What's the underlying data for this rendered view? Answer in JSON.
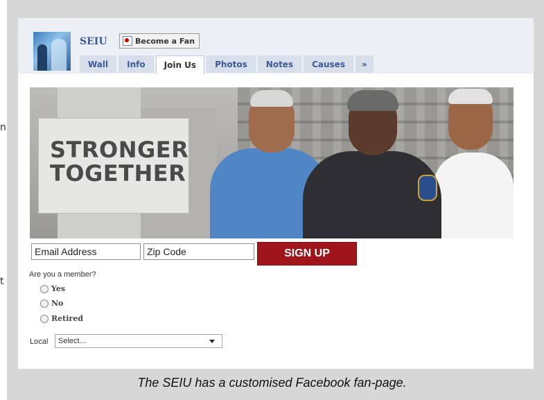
{
  "left_margin": {
    "fragments": [
      "n",
      "t"
    ]
  },
  "page": {
    "name": "SEIU",
    "fan_button_label": "Become a Fan"
  },
  "tabs": [
    {
      "label": "Wall",
      "active": false
    },
    {
      "label": "Info",
      "active": false
    },
    {
      "label": "Join Us",
      "active": true
    },
    {
      "label": "Photos",
      "active": false
    },
    {
      "label": "Notes",
      "active": false
    },
    {
      "label": "Causes",
      "active": false
    },
    {
      "label": "»",
      "active": false
    }
  ],
  "banner": {
    "headline_line1": "STRONGER",
    "headline_line2": "TOGETHER"
  },
  "form": {
    "email_placeholder": "Email Address",
    "zip_placeholder": "Zip Code",
    "signup_label": "SIGN UP",
    "member_question": "Are you a member?",
    "options": [
      "Yes",
      "No",
      "Retired"
    ],
    "local_label": "Local",
    "local_selected": "Select..."
  },
  "caption": "The SEIU has a customised Facebook fan-page.",
  "colors": {
    "facebook_blue": "#3b5998",
    "tab_bg": "#d8dfea",
    "signup_red": "#a0151c",
    "frame_gray": "#d7d7d7"
  }
}
